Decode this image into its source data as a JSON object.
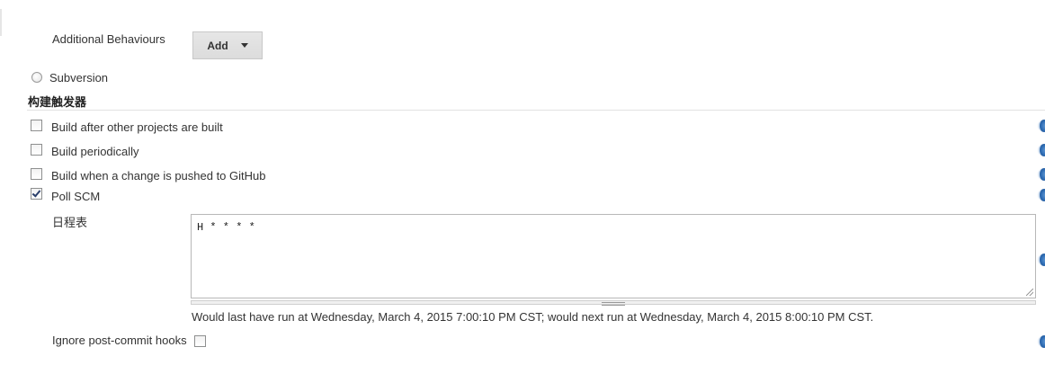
{
  "scm": {
    "additional_behaviours_label": "Additional Behaviours",
    "add_button_label": "Add",
    "subversion_label": "Subversion"
  },
  "triggers": {
    "section_title": "构建触发器",
    "build_after_other_label": "Build after other projects are built",
    "build_periodically_label": "Build periodically",
    "build_on_github_push_label": "Build when a change is pushed to GitHub",
    "poll_scm_label": "Poll SCM",
    "poll_scm_checked": true,
    "schedule_label": "日程表",
    "schedule_value": "H * * * *",
    "schedule_hint": "Would last have run at Wednesday, March 4, 2015 7:00:10 PM CST; would next run at Wednesday, March 4, 2015 8:00:10 PM CST.",
    "ignore_post_commit_label": "Ignore post-commit hooks"
  },
  "icons": {
    "help": "help-icon",
    "dropdown": "caret-down-icon"
  },
  "colors": {
    "help_icon": "#2f6db5",
    "button_bg": "#e0e0e0"
  }
}
